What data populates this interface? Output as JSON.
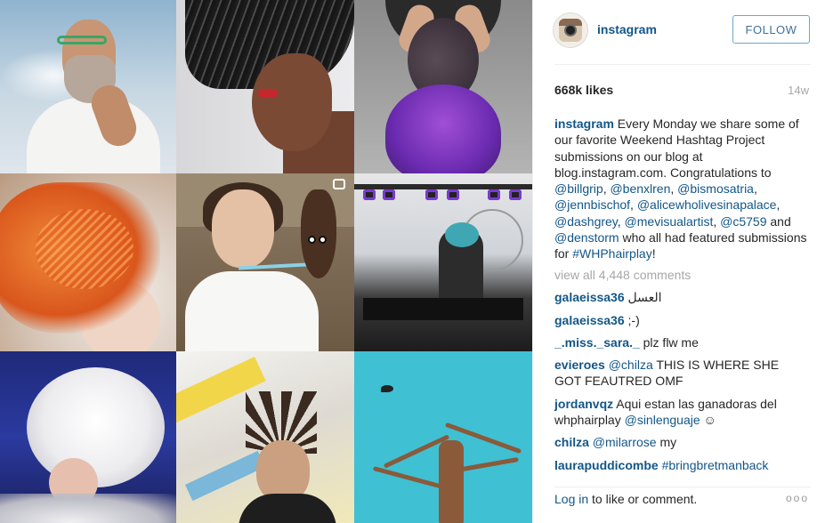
{
  "header": {
    "username": "instagram",
    "follow_label": "FOLLOW"
  },
  "post": {
    "likes": "668k likes",
    "time": "14w",
    "caption": {
      "user": "instagram",
      "text_1": " Every Monday we share some of our favorite Weekend Hashtag Project submissions on our blog at blog.instagram.com. Congratulations to ",
      "mentions": [
        "@billgrip",
        "@benxlren",
        "@bismosatria",
        "@jennbischof",
        "@alicewholivesinapalace",
        "@dashgrey",
        "@mevisualartist",
        "@c5759",
        "@denstorm"
      ],
      "text_2": " who all had featured submissions for ",
      "hashtag": "#WHPhairplay",
      "text_3": "!"
    },
    "view_all": "view all 4,448 comments",
    "comments": [
      {
        "user": "galaeissa36",
        "text": " العسل"
      },
      {
        "user": "galaeissa36",
        "text": " ;-)"
      },
      {
        "user": "_.miss._sara._",
        "text": " plz flw me"
      },
      {
        "user": "evieroes",
        "mention": "@chilza",
        "text": " THIS IS WHERE SHE GOT FEAUTRED OMF"
      },
      {
        "user": "jordanvqz",
        "text": " Aqui estan las ganadoras del whphairplay ",
        "mention": "@sinlenguaje",
        "emoji": " ☺"
      },
      {
        "user": "chilza",
        "mention": "@milarrose",
        "text": " my"
      },
      {
        "user": "laurapuddicombe",
        "hashtag": "#bringbretmanback"
      }
    ]
  },
  "footer": {
    "login_link": "Log in",
    "login_text": " to like or comment.",
    "more": "ooo"
  }
}
